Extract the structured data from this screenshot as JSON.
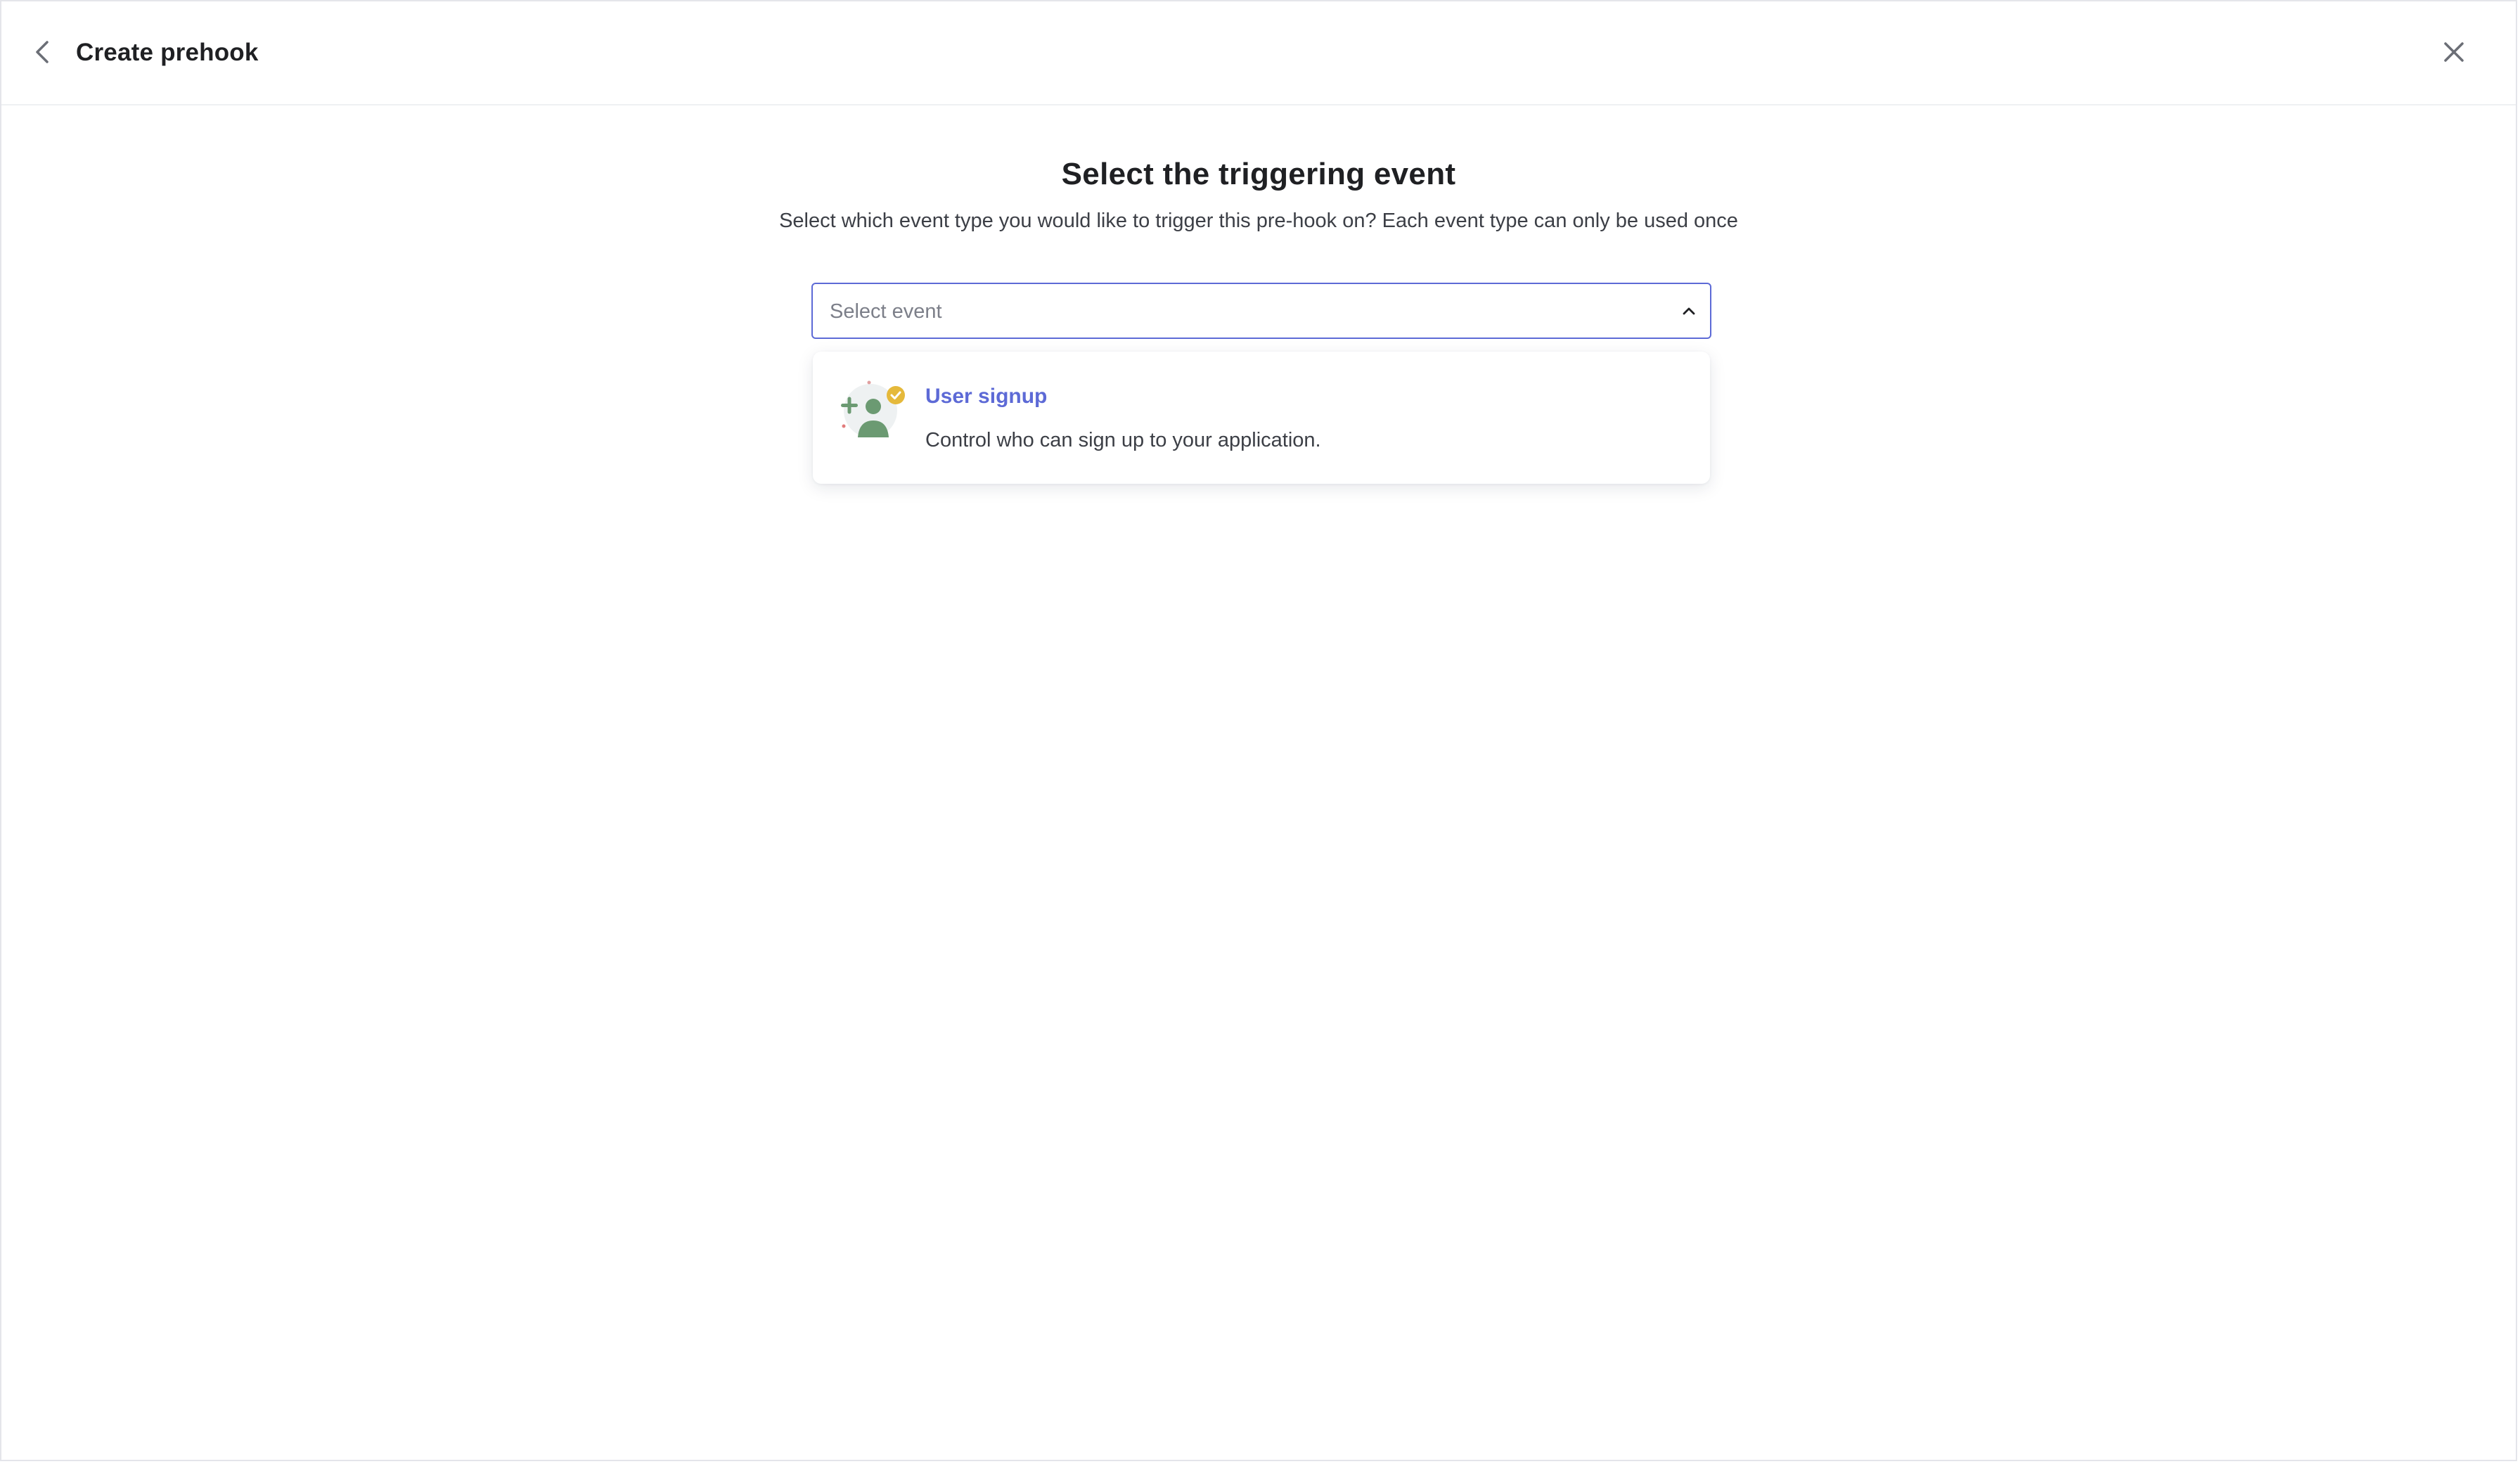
{
  "header": {
    "title": "Create prehook",
    "back_icon": "chevron-left-icon",
    "close_icon": "close-icon"
  },
  "main": {
    "title": "Select the triggering event",
    "subtitle": "Select which event type you would like to trigger this pre-hook on? Each event type can only be used once"
  },
  "event_select": {
    "placeholder": "Select event",
    "expanded": true,
    "chevron_icon": "chevron-up-icon",
    "options": [
      {
        "title": "User signup",
        "description": "Control who can sign up to your application.",
        "icon": "user-signup-icon"
      }
    ]
  },
  "colors": {
    "accent": "#5d6ad6",
    "text_primary": "#1f2023",
    "text_secondary": "#3c3f46",
    "placeholder": "#7c7f89",
    "border": "#e4e5ea",
    "icon_green": "#6b9a72",
    "icon_badge": "#e5b93b"
  }
}
